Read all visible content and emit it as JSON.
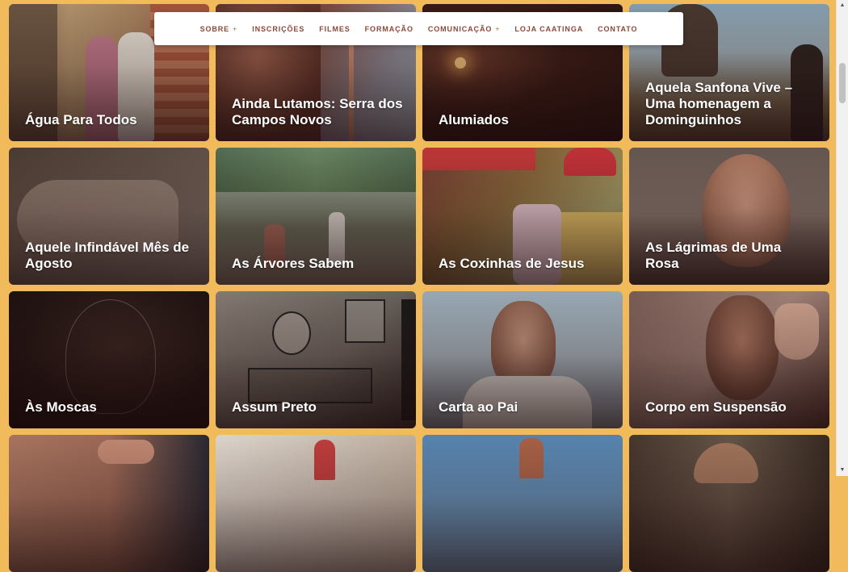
{
  "nav": {
    "items": [
      {
        "label": "SOBRE",
        "has_dropdown": true
      },
      {
        "label": "INSCRIÇÕES",
        "has_dropdown": false
      },
      {
        "label": "FILMES",
        "has_dropdown": false
      },
      {
        "label": "FORMAÇÃO",
        "has_dropdown": false
      },
      {
        "label": "COMUNICAÇÃO",
        "has_dropdown": true
      },
      {
        "label": "LOJA CAATINGA",
        "has_dropdown": false
      },
      {
        "label": "CONTATO",
        "has_dropdown": false
      }
    ],
    "caret": "+"
  },
  "films": [
    {
      "title": "Água Para Todos"
    },
    {
      "title": "Ainda Lutamos: Serra dos Campos Novos"
    },
    {
      "title": "Alumiados"
    },
    {
      "title": "Aquela Sanfona Vive – Uma homenagem a Dominguinhos"
    },
    {
      "title": "Aquele Infindável Mês de Agosto"
    },
    {
      "title": "As Árvores Sabem"
    },
    {
      "title": "As Coxinhas de Jesus"
    },
    {
      "title": "As Lágrimas de Uma Rosa"
    },
    {
      "title": "Às Moscas"
    },
    {
      "title": "Assum Preto"
    },
    {
      "title": "Carta ao Pai"
    },
    {
      "title": "Corpo em Suspensão"
    },
    {
      "title": ""
    },
    {
      "title": ""
    },
    {
      "title": ""
    },
    {
      "title": ""
    }
  ],
  "colors": {
    "page_background": "#f1bb5b",
    "nav_text": "#8a4a38",
    "card_title": "#ffffff"
  },
  "scrollbar": {
    "up_icon": "triangle-up",
    "down_icon": "triangle-down"
  }
}
